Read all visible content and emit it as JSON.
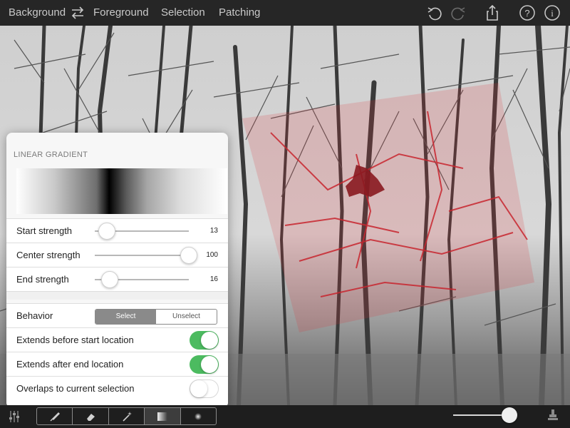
{
  "topbar": {
    "background_label": "Background",
    "foreground_label": "Foreground",
    "selection_label": "Selection",
    "patching_label": "Patching",
    "icons": [
      "swap-icon",
      "undo-icon",
      "redo-icon",
      "share-icon",
      "help-icon",
      "info-icon"
    ]
  },
  "panel": {
    "title": "LINEAR GRADIENT",
    "start_strength": {
      "label": "Start strength",
      "value": "13",
      "level": 0.13
    },
    "center_strength": {
      "label": "Center strength",
      "value": "100",
      "level": 1.0
    },
    "end_strength": {
      "label": "End strength",
      "value": "16",
      "level": 0.16
    },
    "behavior": {
      "label": "Behavior",
      "options": [
        "Select",
        "Unselect"
      ],
      "selected": "Select"
    },
    "extends_before": {
      "label": "Extends before start location",
      "on": true
    },
    "extends_after": {
      "label": "Extends after end location",
      "on": true
    },
    "overlaps": {
      "label": "Overlaps to current selection",
      "on": false
    }
  },
  "bottombar": {
    "tools": [
      "brush-icon",
      "eraser-icon",
      "magic-wand-icon",
      "linear-gradient-icon",
      "radial-gradient-icon"
    ],
    "active_tool": "linear-gradient-icon",
    "brush_size_level": 0.85,
    "right_icon": "stamp-icon"
  },
  "colors": {
    "selection_overlay": "#e0303a",
    "toggle_on": "#4cbb60",
    "toolbar": "#262626"
  }
}
